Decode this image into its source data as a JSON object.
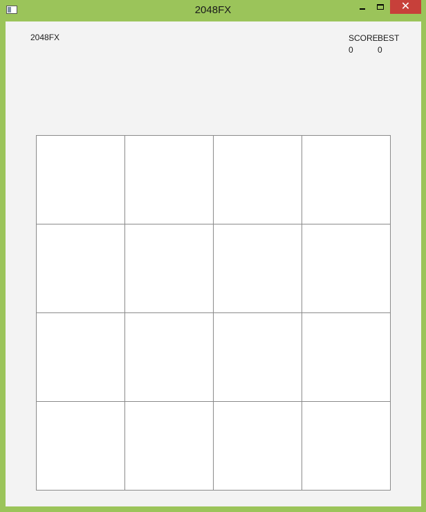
{
  "window": {
    "title": "2048FX",
    "close_label": "✕"
  },
  "header": {
    "app_name": "2048FX",
    "score_label": "SCORE",
    "best_label": "BEST",
    "score_value": "0",
    "best_value": "0"
  },
  "board": {
    "rows": 4,
    "cols": 4,
    "tiles": [
      [
        "",
        "",
        "",
        ""
      ],
      [
        "",
        "",
        "",
        ""
      ],
      [
        "",
        "",
        "",
        ""
      ],
      [
        "",
        "",
        "",
        ""
      ]
    ]
  }
}
